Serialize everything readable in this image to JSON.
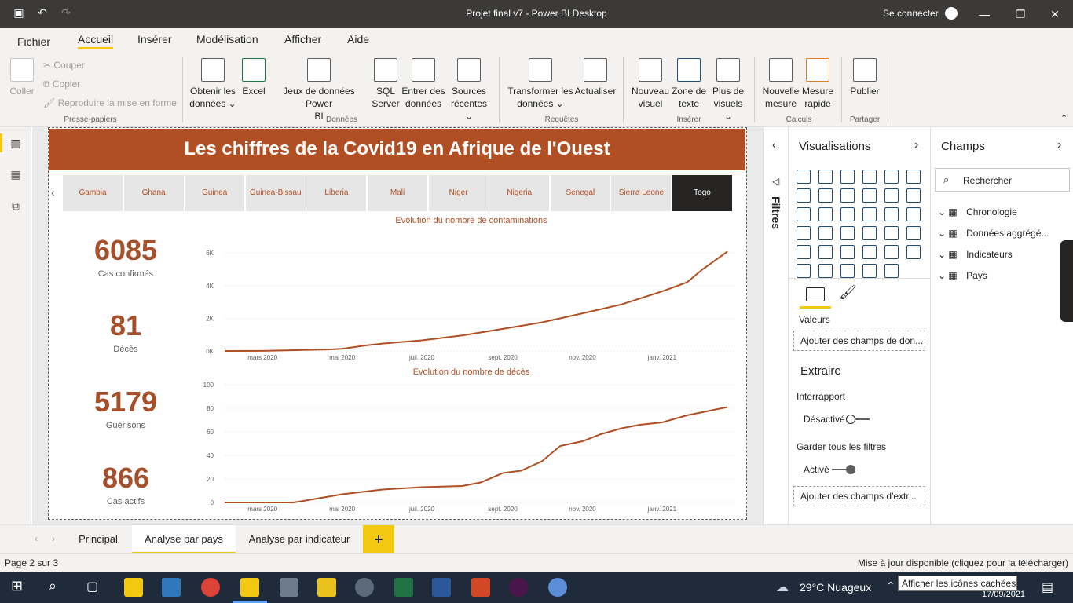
{
  "window": {
    "title": "Projet final v7 - Power BI Desktop",
    "signin": "Se connecter"
  },
  "menu": {
    "items": [
      "Fichier",
      "Accueil",
      "Insérer",
      "Modélisation",
      "Afficher",
      "Aide"
    ]
  },
  "ribbon": {
    "clipboard": {
      "paste": "Coller",
      "cut": "Couper",
      "copy": "Copier",
      "format_painter": "Reproduire la mise en forme",
      "group": "Presse-papiers"
    },
    "data": {
      "get_data_1": "Obtenir les",
      "get_data_2": "données",
      "excel": "Excel",
      "pbi_1": "Jeux de données Power",
      "pbi_2": "BI",
      "sql_1": "SQL",
      "sql_2": "Server",
      "enter_1": "Entrer des",
      "enter_2": "données",
      "recent_1": "Sources",
      "recent_2": "récentes",
      "group": "Données"
    },
    "queries": {
      "transform_1": "Transformer les",
      "transform_2": "données",
      "refresh": "Actualiser",
      "group": "Requêtes"
    },
    "insert": {
      "visual_1": "Nouveau",
      "visual_2": "visuel",
      "text_1": "Zone de",
      "text_2": "texte",
      "more_1": "Plus de",
      "more_2": "visuels",
      "group": "Insérer"
    },
    "calc": {
      "measure_1": "Nouvelle",
      "measure_2": "mesure",
      "quick_1": "Mesure",
      "quick_2": "rapide",
      "group": "Calculs"
    },
    "share": {
      "publish": "Publier",
      "group": "Partager"
    }
  },
  "report": {
    "title": "Les chiffres de la Covid19 en Afrique de l'Ouest",
    "countries": [
      "Gambia",
      "Ghana",
      "Guinea",
      "Guinea-Bissau",
      "Liberia",
      "Mali",
      "Niger",
      "Nigeria",
      "Senegal",
      "Sierra Leone",
      "Togo"
    ],
    "selected_country": "Togo",
    "kpis": [
      {
        "value": "6085",
        "label": "Cas confirmés"
      },
      {
        "value": "81",
        "label": "Décès"
      },
      {
        "value": "5179",
        "label": "Guérisons"
      },
      {
        "value": "866",
        "label": "Cas actifs"
      }
    ]
  },
  "chart_data": [
    {
      "type": "line",
      "title": "Evolution du nombre de contaminations",
      "x_ticks": [
        "mars 2020",
        "mai 2020",
        "juil. 2020",
        "sept. 2020",
        "nov. 2020",
        "janv. 2021"
      ],
      "y_ticks": [
        "0K",
        "2K",
        "4K",
        "6K"
      ],
      "ylim": [
        0,
        6200
      ],
      "x": [
        "2020-02-01",
        "2020-03-01",
        "2020-04-01",
        "2020-04-20",
        "2020-05-01",
        "2020-05-20",
        "2020-06-01",
        "2020-07-01",
        "2020-08-01",
        "2020-09-01",
        "2020-10-01",
        "2020-11-01",
        "2020-12-01",
        "2021-01-01",
        "2021-01-20",
        "2021-02-01",
        "2021-02-20"
      ],
      "series": [
        {
          "values": [
            0,
            5,
            60,
            90,
            130,
            350,
            450,
            650,
            950,
            1350,
            1750,
            2300,
            2850,
            3650,
            4200,
            5000,
            6085
          ]
        }
      ]
    },
    {
      "type": "line",
      "title": "Evolution du nombre de décès",
      "x_ticks": [
        "mars 2020",
        "mai 2020",
        "juil. 2020",
        "sept. 2020",
        "nov. 2020",
        "janv. 2021"
      ],
      "y_ticks": [
        "0",
        "20",
        "40",
        "60",
        "80",
        "100"
      ],
      "ylim": [
        0,
        100
      ],
      "x": [
        "2020-02-01",
        "2020-03-01",
        "2020-03-25",
        "2020-04-10",
        "2020-05-01",
        "2020-06-01",
        "2020-07-01",
        "2020-08-01",
        "2020-08-15",
        "2020-09-01",
        "2020-09-15",
        "2020-10-01",
        "2020-10-15",
        "2020-11-01",
        "2020-11-15",
        "2020-12-01",
        "2020-12-15",
        "2021-01-01",
        "2021-01-20",
        "2021-02-20"
      ],
      "series": [
        {
          "values": [
            0,
            0,
            0,
            3,
            7,
            11,
            13,
            14,
            17,
            25,
            27,
            35,
            48,
            52,
            58,
            63,
            66,
            68,
            74,
            81
          ]
        }
      ]
    }
  ],
  "filters": {
    "label": "Filtres"
  },
  "visualizations": {
    "title": "Visualisations",
    "values_label": "Valeurs",
    "add_fields": "Ajouter des champs de don...",
    "drillthrough": "Extraire",
    "cross_report": "Interrapport",
    "cross_report_state": "Désactivé",
    "keep_filters": "Garder tous les filtres",
    "keep_filters_state": "Activé",
    "add_drill": "Ajouter des champs d'extr..."
  },
  "fields": {
    "title": "Champs",
    "search_placeholder": "Rechercher",
    "tables": [
      "Chronologie",
      "Données aggrégé...",
      "Indicateurs",
      "Pays"
    ]
  },
  "tabs": {
    "items": [
      "Principal",
      "Analyse par pays",
      "Analyse par indicateur"
    ],
    "add": "+"
  },
  "status": {
    "page": "Page 2 sur 3",
    "update": "Mise à jour disponible (cliquez pour la télécharger)"
  },
  "taskbar": {
    "weather": "29°C  Nuageux",
    "tooltip": "Afficher les icônes cachées",
    "date": "17/09/2021"
  },
  "colors": {
    "accent": "#b04f24",
    "line": "#b04f24",
    "yellow": "#f2c811"
  }
}
